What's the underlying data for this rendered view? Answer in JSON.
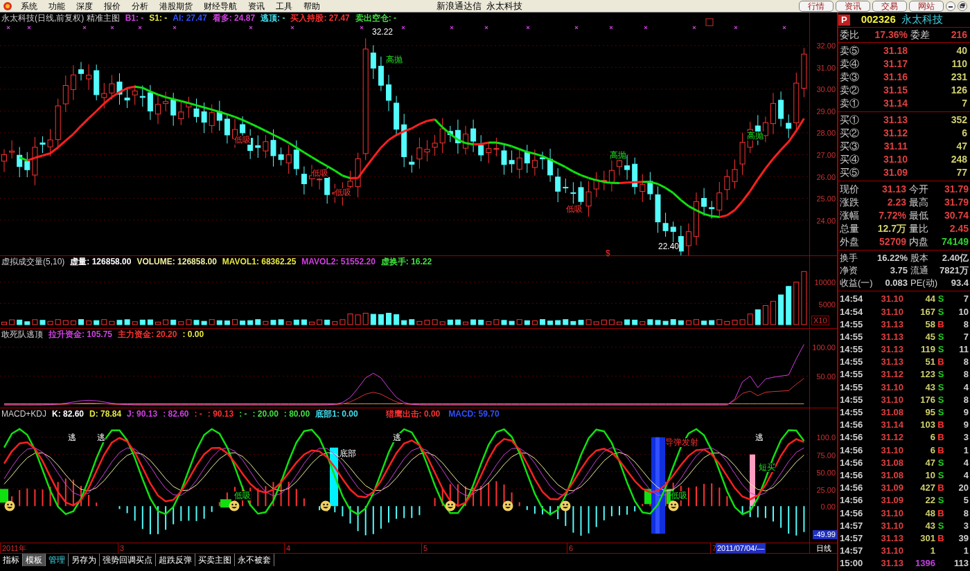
{
  "menu_bar": {
    "items": [
      "系统",
      "功能",
      "深度",
      "报价",
      "分析",
      "港股期货",
      "财经导航",
      "资讯",
      "工具",
      "帮助"
    ],
    "title": "新浪通达信  永太科技",
    "buttons": [
      "行情",
      "资讯",
      "交易",
      "网站"
    ]
  },
  "main_chart": {
    "title": "永太科技(日线,前复权) 精准主图",
    "indicators": [
      {
        "text": "B1: -",
        "color": "#d040e0"
      },
      {
        "text": "S1: -",
        "color": "#e8e840"
      },
      {
        "text": "AI: 27.47",
        "color": "#3050ff"
      },
      {
        "text": "看多: 24.87",
        "color": "#d040e0"
      },
      {
        "text": "逃顶: -",
        "color": "#40e0f0"
      },
      {
        "text": "买入持股: 27.47",
        "color": "#ff3030"
      },
      {
        "text": "卖出空仓: -",
        "color": "#40e040"
      }
    ],
    "annotations": [
      {
        "text": "32.22",
        "kind": "price"
      },
      {
        "text": "高抛",
        "kind": "sell"
      },
      {
        "text": "低吸",
        "kind": "buy"
      },
      {
        "text": "低吸",
        "kind": "buy"
      },
      {
        "text": "低吸",
        "kind": "buy"
      },
      {
        "text": "低吸",
        "kind": "buy"
      },
      {
        "text": "高抛",
        "kind": "sell"
      },
      {
        "text": "22.40",
        "kind": "price"
      },
      {
        "text": "高抛",
        "kind": "sell"
      },
      {
        "text": "$",
        "kind": "buy"
      }
    ],
    "y_axis": [
      "32.00",
      "31.00",
      "30.00",
      "29.00",
      "28.00",
      "27.00",
      "26.00",
      "25.00",
      "24.00"
    ]
  },
  "volume_panel": {
    "title": "虚拟成交量(5,10)",
    "indicators": [
      {
        "text": "虚量: 126858.00",
        "color": "#ffffff"
      },
      {
        "text": "VOLUME: 126858.00",
        "color": "#f0f0a0"
      },
      {
        "text": "MAVOL1: 68362.25",
        "color": "#e8e840"
      },
      {
        "text": "MAVOL2: 51552.20",
        "color": "#d040e0"
      },
      {
        "text": "虚换手: 16.22",
        "color": "#40e040"
      }
    ],
    "y_axis": [
      "10000",
      "5000"
    ],
    "scale_badge": "X10"
  },
  "fund_panel": {
    "title": "敢死队逃顶",
    "indicators": [
      {
        "text": "拉升资金: 105.75",
        "color": "#d040e0"
      },
      {
        "text": "主力资金: 20.20",
        "color": "#ff3030"
      },
      {
        "text": ": 0.00",
        "color": "#e8e840"
      }
    ],
    "y_axis": [
      "100.00",
      "50.00"
    ]
  },
  "macd_panel": {
    "title": "MACD+KDJ",
    "indicators": [
      {
        "text": "K: 82.60",
        "color": "#ffffff"
      },
      {
        "text": "D: 78.84",
        "color": "#e8e840"
      },
      {
        "text": "J: 90.13",
        "color": "#d040e0"
      },
      {
        "text": ": 82.60",
        "color": "#d040e0"
      },
      {
        "text": ": -",
        "color": "#ff3030"
      },
      {
        "text": ": 90.13",
        "color": "#ff3030"
      },
      {
        "text": ": -",
        "color": "#40e040"
      },
      {
        "text": ": 20.00",
        "color": "#40e040"
      },
      {
        "text": ": 80.00",
        "color": "#40e040"
      },
      {
        "text": "底部1: 0.00",
        "color": "#40e0f0"
      }
    ],
    "right_indicators": [
      {
        "text": "猎鹰出击: 0.00",
        "color": "#ff3030"
      },
      {
        "text": "MACD: 59.70",
        "color": "#3050ff"
      }
    ],
    "annotations": [
      {
        "text": "逃",
        "kind": "escape"
      },
      {
        "text": "逃",
        "kind": "escape"
      },
      {
        "text": "底部",
        "kind": "bottom"
      },
      {
        "text": "逃",
        "kind": "escape"
      },
      {
        "text": "导弹发射",
        "kind": "missile"
      },
      {
        "text": "逃",
        "kind": "escape"
      },
      {
        "text": "短买",
        "kind": "buy"
      },
      {
        "text": "低吸",
        "kind": "dip"
      },
      {
        "text": "低吸",
        "kind": "dip"
      }
    ],
    "y_axis": [
      "100.0",
      "75.00",
      "50.00",
      "25.00",
      "0.00"
    ],
    "cursor_value": "-49.99"
  },
  "x_axis": {
    "labels": [
      "2011年",
      "3",
      "4",
      "5",
      "6",
      "7"
    ],
    "cursor_date": "2011/07/04/—",
    "period": "日线"
  },
  "bottom_tabs": [
    {
      "label": "指标",
      "selected": false,
      "highlighted": false
    },
    {
      "label": "模板",
      "selected": true,
      "highlighted": false
    },
    {
      "label": "管理",
      "selected": false,
      "highlighted": true
    },
    {
      "label": "另存为",
      "selected": false,
      "highlighted": false
    },
    {
      "label": "强势回调买点",
      "selected": false,
      "highlighted": false
    },
    {
      "label": "超跌反弹",
      "selected": false,
      "highlighted": false
    },
    {
      "label": "买卖主图",
      "selected": false,
      "highlighted": false
    },
    {
      "label": "永不被套",
      "selected": false,
      "highlighted": false
    }
  ],
  "quote_panel": {
    "badge": "P",
    "code": "002326",
    "name": "永太科技",
    "ratio": {
      "label": "委比",
      "value": "17.36%",
      "label2": "委差",
      "value2": "216"
    },
    "asks": [
      {
        "label": "卖⑤",
        "price": "31.18",
        "volume": "40"
      },
      {
        "label": "卖④",
        "price": "31.17",
        "volume": "110"
      },
      {
        "label": "卖③",
        "price": "31.16",
        "volume": "231"
      },
      {
        "label": "卖②",
        "price": "31.15",
        "volume": "126"
      },
      {
        "label": "卖①",
        "price": "31.14",
        "volume": "7"
      }
    ],
    "bids": [
      {
        "label": "买①",
        "price": "31.13",
        "volume": "352"
      },
      {
        "label": "买②",
        "price": "31.12",
        "volume": "6"
      },
      {
        "label": "买③",
        "price": "31.11",
        "volume": "47"
      },
      {
        "label": "买④",
        "price": "31.10",
        "volume": "248"
      },
      {
        "label": "买⑤",
        "price": "31.09",
        "volume": "77"
      }
    ],
    "stats": [
      {
        "cells": [
          {
            "label": "现价",
            "value": "31.13",
            "color": "#e04040"
          },
          {
            "label": "今开",
            "value": "31.79",
            "color": "#e04040"
          }
        ]
      },
      {
        "cells": [
          {
            "label": "涨跌",
            "value": "2.23",
            "color": "#e04040"
          },
          {
            "label": "最高",
            "value": "31.79",
            "color": "#e04040"
          }
        ]
      },
      {
        "cells": [
          {
            "label": "涨幅",
            "value": "7.72%",
            "color": "#e04040"
          },
          {
            "label": "最低",
            "value": "30.74",
            "color": "#e04040"
          }
        ]
      },
      {
        "cells": [
          {
            "label": "总量",
            "value": "12.7万",
            "color": "#d0d070"
          },
          {
            "label": "量比",
            "value": "2.45",
            "color": "#e04040"
          }
        ]
      },
      {
        "cells": [
          {
            "label": "外盘",
            "value": "52709",
            "color": "#e04040"
          },
          {
            "label": "内盘",
            "value": "74149",
            "color": "#30d030"
          }
        ]
      }
    ],
    "finance": [
      {
        "label": "换手",
        "value": "16.22%",
        "label2": "股本",
        "value2": "2.40亿"
      },
      {
        "label": "净资",
        "value": "3.75",
        "label2": "流通",
        "value2": "7821万"
      },
      {
        "label": "收益(一)",
        "value": "0.083",
        "label2": "PE(动)",
        "value2": "93.4"
      }
    ],
    "trades": [
      {
        "time": "14:54",
        "price": "31.10",
        "volume": "44",
        "side": "S",
        "kind": "sell",
        "count": "7",
        "summary": false
      },
      {
        "time": "14:54",
        "price": "31.10",
        "volume": "167",
        "side": "S",
        "kind": "sell",
        "count": "10",
        "summary": false
      },
      {
        "time": "14:55",
        "price": "31.13",
        "volume": "58",
        "side": "B",
        "kind": "buy",
        "count": "8",
        "summary": false
      },
      {
        "time": "14:55",
        "price": "31.13",
        "volume": "45",
        "side": "S",
        "kind": "sell",
        "count": "7",
        "summary": false
      },
      {
        "time": "14:55",
        "price": "31.13",
        "volume": "119",
        "side": "S",
        "kind": "sell",
        "count": "11",
        "summary": false
      },
      {
        "time": "14:55",
        "price": "31.13",
        "volume": "51",
        "side": "B",
        "kind": "buy",
        "count": "8",
        "summary": false
      },
      {
        "time": "14:55",
        "price": "31.12",
        "volume": "123",
        "side": "S",
        "kind": "sell",
        "count": "8",
        "summary": false
      },
      {
        "time": "14:55",
        "price": "31.10",
        "volume": "43",
        "side": "S",
        "kind": "sell",
        "count": "4",
        "summary": false
      },
      {
        "time": "14:55",
        "price": "31.10",
        "volume": "176",
        "side": "S",
        "kind": "sell",
        "count": "8",
        "summary": false
      },
      {
        "time": "14:55",
        "price": "31.08",
        "volume": "95",
        "side": "S",
        "kind": "sell",
        "count": "9",
        "summary": false
      },
      {
        "time": "14:56",
        "price": "31.14",
        "volume": "103",
        "side": "B",
        "kind": "buy",
        "count": "9",
        "summary": false
      },
      {
        "time": "14:56",
        "price": "31.12",
        "volume": "6",
        "side": "B",
        "kind": "buy",
        "count": "3",
        "summary": false
      },
      {
        "time": "14:56",
        "price": "31.10",
        "volume": "6",
        "side": "B",
        "kind": "buy",
        "count": "1",
        "summary": false
      },
      {
        "time": "14:56",
        "price": "31.08",
        "volume": "47",
        "side": "S",
        "kind": "sell",
        "count": "4",
        "summary": false
      },
      {
        "time": "14:56",
        "price": "31.08",
        "volume": "10",
        "side": "S",
        "kind": "sell",
        "count": "4",
        "summary": false
      },
      {
        "time": "14:56",
        "price": "31.09",
        "volume": "427",
        "side": "B",
        "kind": "buy",
        "count": "20",
        "summary": false
      },
      {
        "time": "14:56",
        "price": "31.09",
        "volume": "22",
        "side": "S",
        "kind": "sell",
        "count": "5",
        "summary": false
      },
      {
        "time": "14:56",
        "price": "31.10",
        "volume": "48",
        "side": "B",
        "kind": "buy",
        "count": "8",
        "summary": false
      },
      {
        "time": "14:57",
        "price": "31.10",
        "volume": "43",
        "side": "S",
        "kind": "sell",
        "count": "3",
        "summary": false
      },
      {
        "time": "14:57",
        "price": "31.13",
        "volume": "301",
        "side": "B",
        "kind": "buy",
        "count": "39",
        "summary": false
      },
      {
        "time": "14:57",
        "price": "31.10",
        "volume": "1",
        "count": "1",
        "summary": false
      },
      {
        "time": "15:00",
        "price": "31.13",
        "volume": "1396",
        "count": "113",
        "summary": true
      }
    ]
  }
}
